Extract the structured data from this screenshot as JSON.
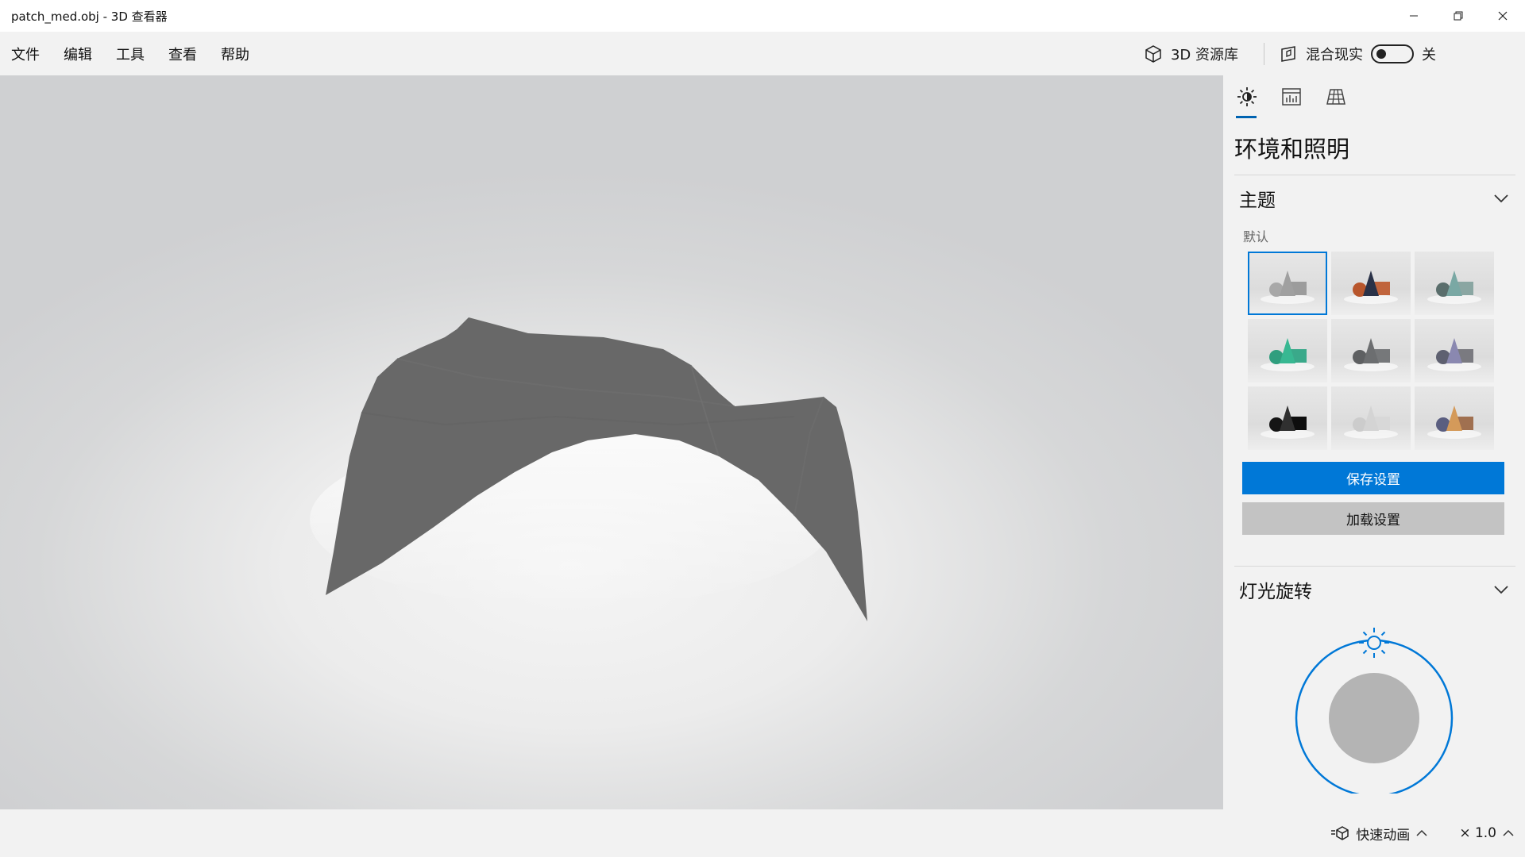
{
  "window": {
    "title": "patch_med.obj - 3D 查看器"
  },
  "menu": {
    "items": [
      {
        "label": "文件"
      },
      {
        "label": "编辑"
      },
      {
        "label": "工具"
      },
      {
        "label": "查看"
      },
      {
        "label": "帮助"
      }
    ],
    "library_label": "3D 资源库",
    "mixed_reality_label": "混合现实",
    "toggle_state": "关"
  },
  "panel": {
    "tabs": [
      {
        "icon": "sun-icon",
        "active": true
      },
      {
        "icon": "stats-icon",
        "active": false
      },
      {
        "icon": "grid-icon",
        "active": false
      }
    ],
    "title": "环境和照明",
    "theme_section": {
      "label": "主题",
      "selected_name": "默认",
      "themes": [
        {
          "sphere": "#a8a8a8",
          "cone": "#a0a0a0",
          "box": "#9c9c9c",
          "selected": true
        },
        {
          "sphere": "#b8562c",
          "cone": "#2a3248",
          "box": "#c0643c",
          "selected": false
        },
        {
          "sphere": "#5a6e6c",
          "cone": "#7aa8a4",
          "box": "#8aa6a2",
          "selected": false
        },
        {
          "sphere": "#2f9e7e",
          "cone": "#38b892",
          "box": "#3aa98a",
          "selected": false
        },
        {
          "sphere": "#5e6062",
          "cone": "#6c6e70",
          "box": "#76787a",
          "selected": false
        },
        {
          "sphere": "#5e6070",
          "cone": "#8a88b0",
          "box": "#7a7a80",
          "selected": false
        },
        {
          "sphere": "#151515",
          "cone": "#303030",
          "box": "#0e0e0e",
          "selected": false
        },
        {
          "sphere": "#cccccc",
          "cone": "#d4d4d4",
          "box": "#d8d8d8",
          "selected": false
        },
        {
          "sphere": "#5a5e80",
          "cone": "#d49a5a",
          "box": "#a07050",
          "selected": false
        }
      ],
      "save_label": "保存设置",
      "load_label": "加载设置"
    },
    "light_section": {
      "label": "灯光旋转"
    }
  },
  "statusbar": {
    "animation_label": "快速动画",
    "speed_label": "× 1.0"
  },
  "colors": {
    "accent": "#0078d7",
    "model": "#686868"
  }
}
